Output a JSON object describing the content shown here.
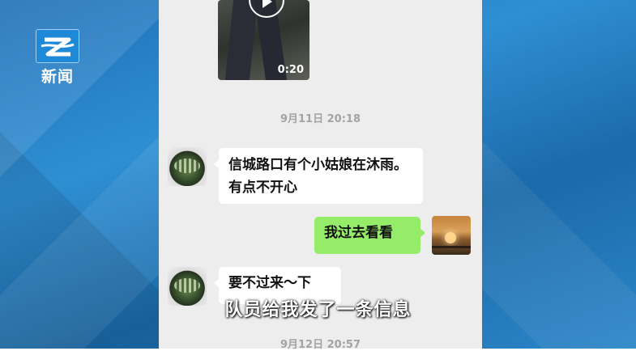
{
  "branding": {
    "logo_text": "新闻",
    "accent": "#1e89d6"
  },
  "video": {
    "duration": "0:20",
    "icon": "play-icon"
  },
  "timestamps": [
    "9月11日 20:18",
    "9月12日 20:57"
  ],
  "messages": [
    {
      "from": "other",
      "text": "信城路口有个小姑娘在沐雨。有点不开心"
    },
    {
      "from": "self",
      "text": "我过去看看"
    },
    {
      "from": "other",
      "text": "要不过来～下"
    }
  ],
  "subtitle": "队员给我发了一条信息",
  "colors": {
    "self_bubble": "#95ec69",
    "chat_bg": "#ededed"
  }
}
